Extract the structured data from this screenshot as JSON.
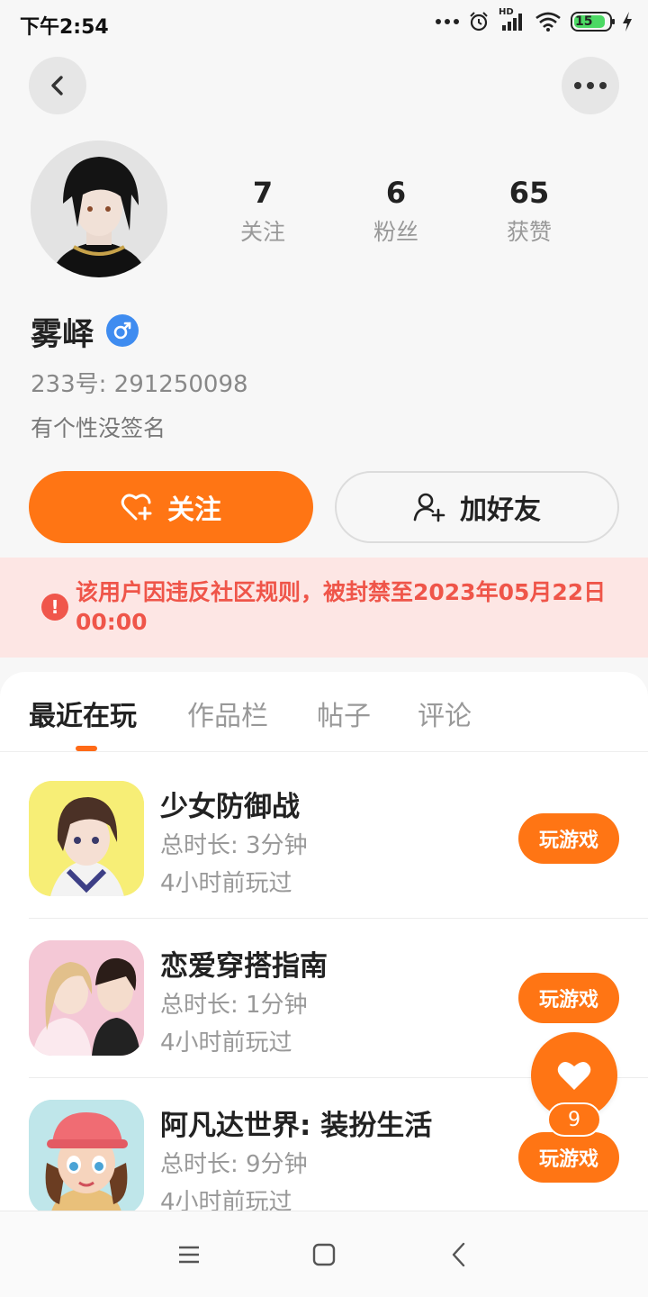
{
  "status_bar": {
    "time": "下午2:54",
    "battery": "15",
    "network": "HD",
    "icons": [
      "more-dots-icon",
      "alarm-icon",
      "signal-icon",
      "wifi-icon",
      "battery-icon",
      "charging-icon"
    ]
  },
  "header": {
    "back_icon": "chevron-left-icon",
    "more_icon": "more-horizontal-icon"
  },
  "profile": {
    "username": "雾峄",
    "gender_icon": "male-icon",
    "uid_text": "233号: 291250098",
    "signature": "有个性没签名",
    "stats": [
      {
        "value": "7",
        "label": "关注"
      },
      {
        "value": "6",
        "label": "粉丝"
      },
      {
        "value": "65",
        "label": "获赞"
      }
    ]
  },
  "actions": {
    "follow_label": "关注",
    "add_friend_label": "加好友"
  },
  "ban_notice": {
    "text": "该用户因违反社区规则，被封禁至2023年05月22日 00:00"
  },
  "tabs": [
    {
      "label": "最近在玩",
      "active": true
    },
    {
      "label": "作品栏",
      "active": false
    },
    {
      "label": "帖子",
      "active": false
    },
    {
      "label": "评论",
      "active": false
    }
  ],
  "games": [
    {
      "title": "少女防御战",
      "duration": "总时长: 3分钟",
      "last_played": "4小时前玩过",
      "button": "玩游戏"
    },
    {
      "title": "恋爱穿搭指南",
      "duration": "总时长: 1分钟",
      "last_played": "4小时前玩过",
      "button": "玩游戏"
    },
    {
      "title": "阿凡达世界: 装扮生活",
      "duration": "总时长: 9分钟",
      "last_played": "4小时前玩过",
      "button": "玩游戏"
    }
  ],
  "like_fab": {
    "count": "9"
  },
  "colors": {
    "accent": "#ff7514",
    "ban_bg": "#fde6e4",
    "ban_text": "#ef5549",
    "battery_fill": "#4cd964",
    "gender_blue": "#3f8cf0"
  }
}
